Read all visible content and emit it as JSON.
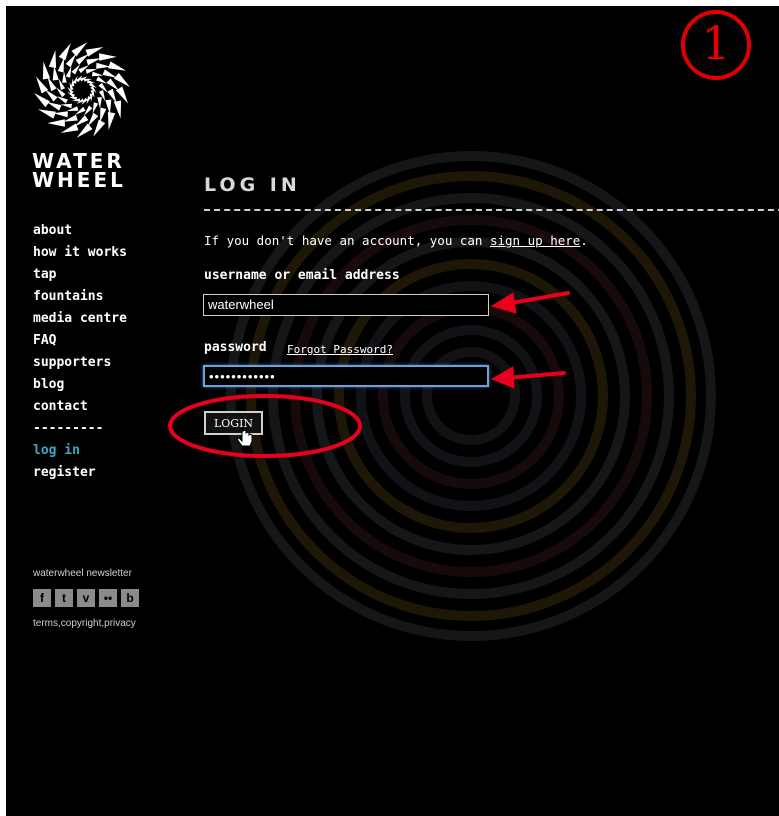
{
  "brand": {
    "line1": "WATER",
    "line2": "WHEEL"
  },
  "nav": {
    "items": [
      {
        "label": "about"
      },
      {
        "label": "how it works"
      },
      {
        "label": "tap"
      },
      {
        "label": "fountains"
      },
      {
        "label": "media centre"
      },
      {
        "label": "FAQ"
      },
      {
        "label": "supporters"
      },
      {
        "label": "blog"
      },
      {
        "label": "contact"
      },
      {
        "label": "---------"
      },
      {
        "label": "log in"
      },
      {
        "label": "register"
      }
    ]
  },
  "footer": {
    "newsletter": "waterwheel newsletter",
    "social": [
      {
        "glyph": "f",
        "icon": "facebook-icon"
      },
      {
        "glyph": "t",
        "icon": "twitter-icon"
      },
      {
        "glyph": "v",
        "icon": "vimeo-icon"
      },
      {
        "glyph": "••",
        "icon": "flickr-icon"
      },
      {
        "glyph": "b",
        "icon": "blogger-icon"
      }
    ],
    "legal": "terms,copyright,privacy"
  },
  "login": {
    "title": "LOG IN",
    "intro_prefix": "If you don't have an account, you can ",
    "intro_link": "sign up here",
    "intro_suffix": ".",
    "username_label": "username or email address",
    "username_value": "waterwheel",
    "password_label": "password",
    "forgot_link": "Forgot Password?",
    "password_value": "••••••••••••",
    "submit_label": "LOGIN"
  },
  "annotation": {
    "step_number": "1",
    "color": "#e10000"
  },
  "colors": {
    "background": "#000000",
    "active_nav": "#3aa9c9",
    "focus_border": "#6ea1d8"
  }
}
